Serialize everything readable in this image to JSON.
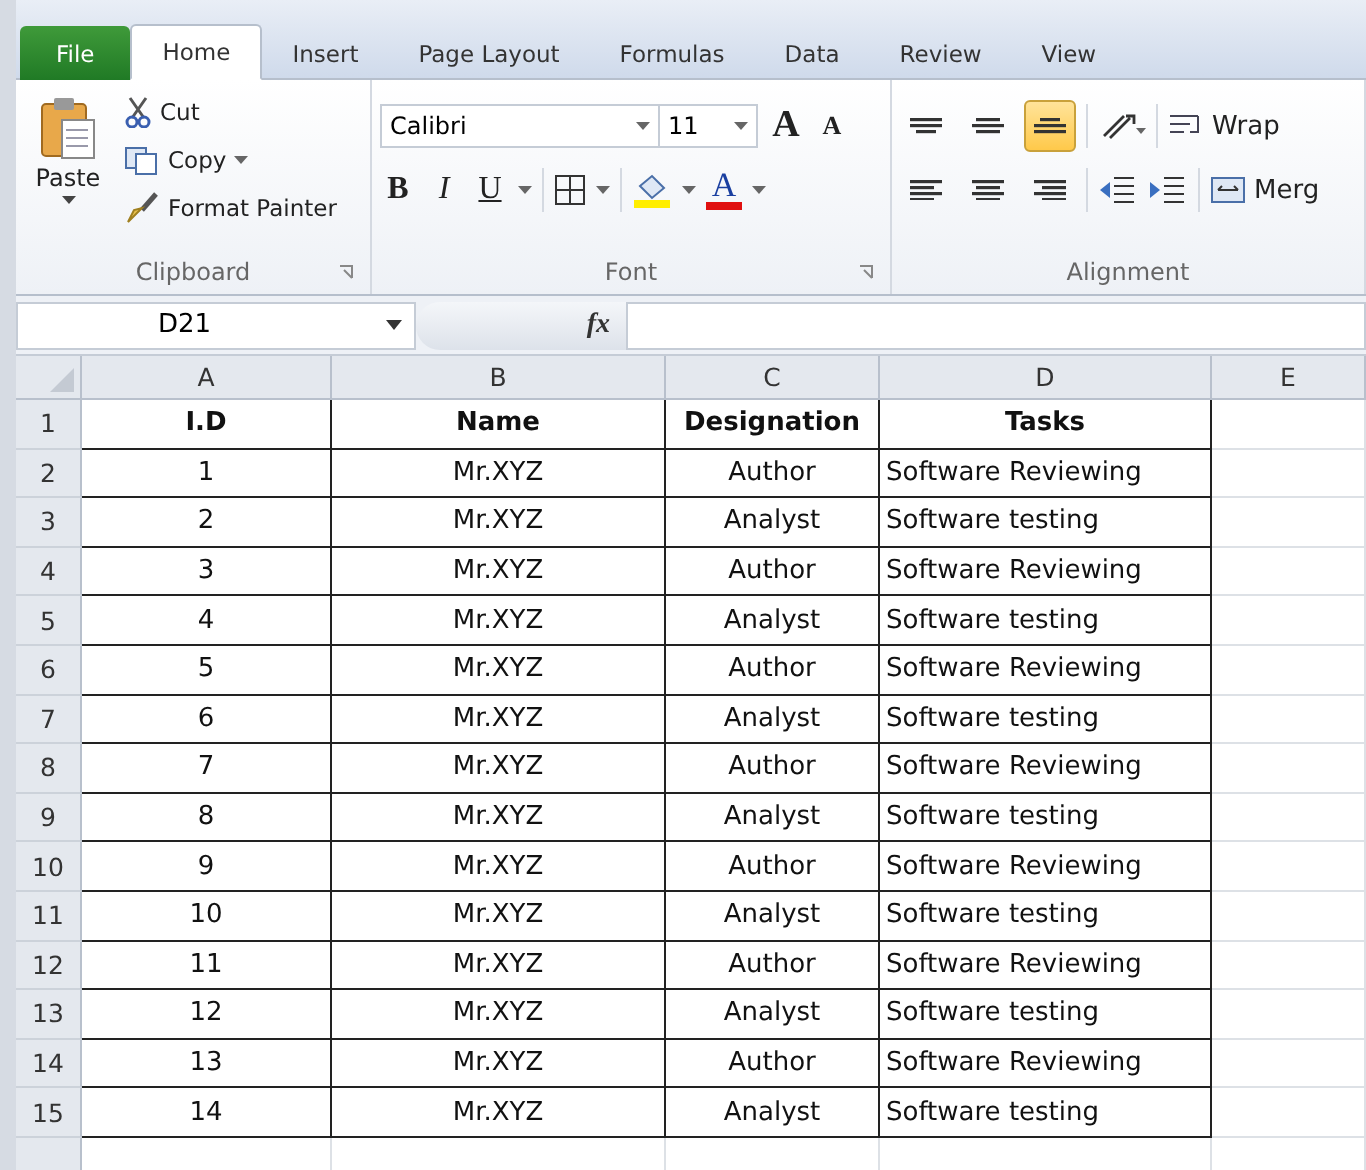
{
  "tabs": [
    {
      "label": "File",
      "kind": "file",
      "selected": false
    },
    {
      "label": "Home",
      "kind": "tab",
      "selected": true
    },
    {
      "label": "Insert",
      "kind": "tab",
      "selected": false
    },
    {
      "label": "Page Layout",
      "kind": "tab",
      "selected": false
    },
    {
      "label": "Formulas",
      "kind": "tab",
      "selected": false
    },
    {
      "label": "Data",
      "kind": "tab",
      "selected": false
    },
    {
      "label": "Review",
      "kind": "tab",
      "selected": false
    },
    {
      "label": "View",
      "kind": "tab",
      "selected": false
    }
  ],
  "clipboard": {
    "label": "Clipboard",
    "paste": "Paste",
    "cut": "Cut",
    "copy": "Copy",
    "format_painter": "Format Painter"
  },
  "font": {
    "label": "Font",
    "name": "Calibri",
    "size": "11",
    "grow": "A",
    "shrink": "A",
    "bold": "B",
    "italic": "I",
    "underline": "U",
    "font_color": "A"
  },
  "alignment": {
    "label": "Alignment",
    "wrap": "Wrap",
    "merge": "Merg",
    "top_row": [
      {
        "kind": "top",
        "selected": false
      },
      {
        "kind": "middle",
        "selected": false
      },
      {
        "kind": "bottom",
        "selected": true
      }
    ],
    "bottom_row": [
      {
        "kind": "left",
        "selected": false
      },
      {
        "kind": "center",
        "selected": false
      },
      {
        "kind": "right",
        "selected": false
      }
    ]
  },
  "formula_bar": {
    "name_box": "D21",
    "fx": "fx"
  },
  "columns": [
    "A",
    "B",
    "C",
    "D",
    "E"
  ],
  "rows": [
    {
      "num": "1",
      "cells": [
        "I.D",
        "Name",
        "Designation",
        "Tasks"
      ],
      "header": true
    },
    {
      "num": "2",
      "cells": [
        "1",
        "Mr.XYZ",
        "Author",
        "Software Reviewing"
      ],
      "header": false
    },
    {
      "num": "3",
      "cells": [
        "2",
        "Mr.XYZ",
        "Analyst",
        "Software testing"
      ],
      "header": false
    },
    {
      "num": "4",
      "cells": [
        "3",
        "Mr.XYZ",
        "Author",
        "Software Reviewing"
      ],
      "header": false
    },
    {
      "num": "5",
      "cells": [
        "4",
        "Mr.XYZ",
        "Analyst",
        "Software testing"
      ],
      "header": false
    },
    {
      "num": "6",
      "cells": [
        "5",
        "Mr.XYZ",
        "Author",
        "Software Reviewing"
      ],
      "header": false
    },
    {
      "num": "7",
      "cells": [
        "6",
        "Mr.XYZ",
        "Analyst",
        "Software testing"
      ],
      "header": false
    },
    {
      "num": "8",
      "cells": [
        "7",
        "Mr.XYZ",
        "Author",
        "Software Reviewing"
      ],
      "header": false
    },
    {
      "num": "9",
      "cells": [
        "8",
        "Mr.XYZ",
        "Analyst",
        "Software testing"
      ],
      "header": false
    },
    {
      "num": "10",
      "cells": [
        "9",
        "Mr.XYZ",
        "Author",
        "Software Reviewing"
      ],
      "header": false
    },
    {
      "num": "11",
      "cells": [
        "10",
        "Mr.XYZ",
        "Analyst",
        "Software testing"
      ],
      "header": false
    },
    {
      "num": "12",
      "cells": [
        "11",
        "Mr.XYZ",
        "Author",
        "Software Reviewing"
      ],
      "header": false
    },
    {
      "num": "13",
      "cells": [
        "12",
        "Mr.XYZ",
        "Analyst",
        "Software testing"
      ],
      "header": false
    },
    {
      "num": "14",
      "cells": [
        "13",
        "Mr.XYZ",
        "Author",
        "Software Reviewing"
      ],
      "header": false
    },
    {
      "num": "15",
      "cells": [
        "14",
        "Mr.XYZ",
        "Analyst",
        "Software testing"
      ],
      "header": false
    }
  ]
}
